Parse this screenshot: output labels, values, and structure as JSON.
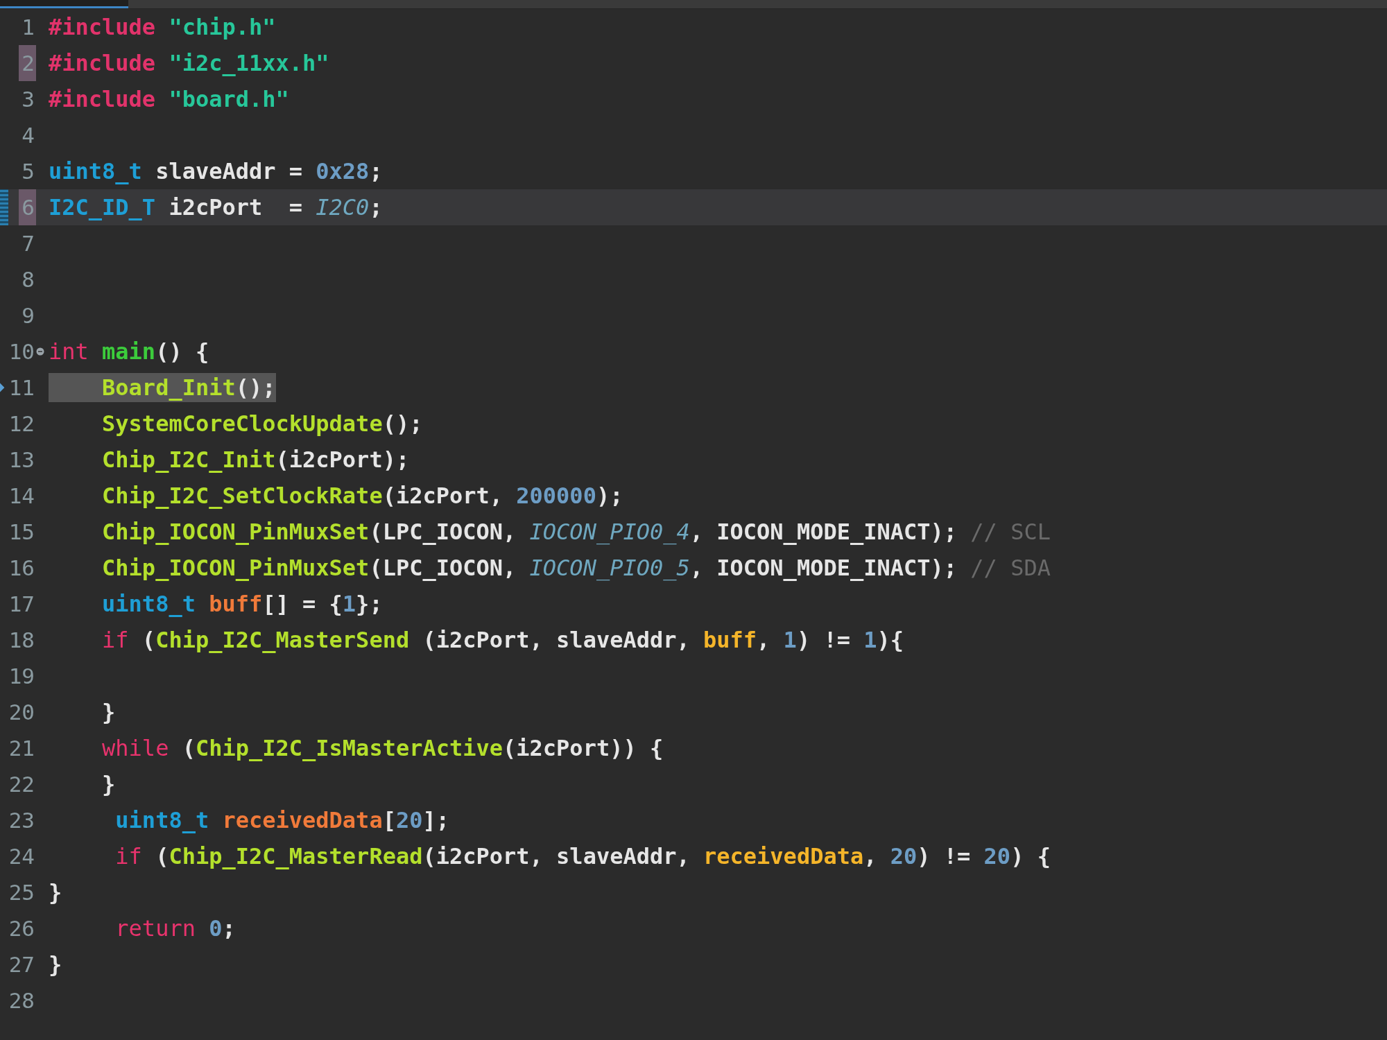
{
  "lines": [
    {
      "number": "1",
      "current": false,
      "bookmark": false,
      "fold": false,
      "pointer": false,
      "selection": false,
      "tokens": [
        {
          "text": "#include ",
          "kind": "directive"
        },
        {
          "text": "\"chip.h\"",
          "kind": "string"
        }
      ]
    },
    {
      "number": "2",
      "current": false,
      "bookmark": true,
      "fold": false,
      "pointer": false,
      "selection": false,
      "tokens": [
        {
          "text": "#include ",
          "kind": "directive"
        },
        {
          "text": "\"i2c_11xx.h\"",
          "kind": "string"
        }
      ]
    },
    {
      "number": "3",
      "current": false,
      "bookmark": false,
      "fold": false,
      "pointer": false,
      "selection": false,
      "tokens": [
        {
          "text": "#include ",
          "kind": "directive"
        },
        {
          "text": "\"board.h\"",
          "kind": "string"
        }
      ]
    },
    {
      "number": "4",
      "current": false,
      "bookmark": false,
      "fold": false,
      "pointer": false,
      "selection": false
    },
    {
      "number": "5",
      "current": false,
      "bookmark": false,
      "fold": false,
      "pointer": false,
      "selection": false,
      "tokens": [
        {
          "text": "uint8_t",
          "kind": "type"
        },
        {
          "text": " slaveAddr = ",
          "kind": "plain"
        },
        {
          "text": "0x28",
          "kind": "number"
        },
        {
          "text": ";",
          "kind": "plain"
        }
      ]
    },
    {
      "number": "6",
      "current": true,
      "bookmark": true,
      "fold": false,
      "pointer": false,
      "selection": false,
      "tokens": [
        {
          "text": "I2C_ID_T",
          "kind": "type"
        },
        {
          "text": " i2cPort  = ",
          "kind": "plain"
        },
        {
          "text": "I2C0",
          "kind": "constant"
        },
        {
          "text": ";",
          "kind": "plain"
        }
      ]
    },
    {
      "number": "7",
      "current": false,
      "bookmark": false,
      "fold": false,
      "pointer": false,
      "selection": false
    },
    {
      "number": "8",
      "current": false,
      "bookmark": false,
      "fold": false,
      "pointer": false,
      "selection": false
    },
    {
      "number": "9",
      "current": false,
      "bookmark": false,
      "fold": false,
      "pointer": false,
      "selection": false
    },
    {
      "number": "10",
      "current": false,
      "bookmark": false,
      "fold": true,
      "pointer": false,
      "selection": false,
      "tokens": [
        {
          "text": "int ",
          "kind": "keyword"
        },
        {
          "text": "main",
          "kind": "entry"
        },
        {
          "text": "() {",
          "kind": "plain"
        }
      ]
    },
    {
      "number": "11",
      "current": false,
      "bookmark": false,
      "fold": false,
      "pointer": true,
      "selection": true,
      "tokens": [
        {
          "text": "    Board_Init",
          "kind": "function"
        },
        {
          "text": "();",
          "kind": "plain"
        }
      ]
    },
    {
      "number": "12",
      "current": false,
      "bookmark": false,
      "fold": false,
      "pointer": false,
      "selection": false,
      "tokens": [
        {
          "text": "    SystemCoreClockUpdate",
          "kind": "function"
        },
        {
          "text": "();",
          "kind": "plain"
        }
      ]
    },
    {
      "number": "13",
      "current": false,
      "bookmark": false,
      "fold": false,
      "pointer": false,
      "selection": false,
      "tokens": [
        {
          "text": "    Chip_I2C_Init",
          "kind": "function"
        },
        {
          "text": "(i2cPort);",
          "kind": "plain"
        }
      ]
    },
    {
      "number": "14",
      "current": false,
      "bookmark": false,
      "fold": false,
      "pointer": false,
      "selection": false,
      "tokens": [
        {
          "text": "    Chip_I2C_SetClockRate",
          "kind": "function"
        },
        {
          "text": "(i2cPort, ",
          "kind": "plain"
        },
        {
          "text": "200000",
          "kind": "number"
        },
        {
          "text": ");",
          "kind": "plain"
        }
      ]
    },
    {
      "number": "15",
      "current": false,
      "bookmark": false,
      "fold": false,
      "pointer": false,
      "selection": false,
      "tokens": [
        {
          "text": "    Chip_IOCON_PinMuxSet",
          "kind": "function"
        },
        {
          "text": "(LPC_IOCON, ",
          "kind": "plain"
        },
        {
          "text": "IOCON_PIO0_4",
          "kind": "constant"
        },
        {
          "text": ", IOCON_MODE_INACT); ",
          "kind": "plain"
        },
        {
          "text": "// SCL",
          "kind": "comment"
        }
      ]
    },
    {
      "number": "16",
      "current": false,
      "bookmark": false,
      "fold": false,
      "pointer": false,
      "selection": false,
      "tokens": [
        {
          "text": "    Chip_IOCON_PinMuxSet",
          "kind": "function"
        },
        {
          "text": "(LPC_IOCON, ",
          "kind": "plain"
        },
        {
          "text": "IOCON_PIO0_5",
          "kind": "constant"
        },
        {
          "text": ", IOCON_MODE_INACT); ",
          "kind": "plain"
        },
        {
          "text": "// SDA",
          "kind": "comment"
        }
      ]
    },
    {
      "number": "17",
      "current": false,
      "bookmark": false,
      "fold": false,
      "pointer": false,
      "selection": false,
      "tokens": [
        {
          "text": "    uint8_t ",
          "kind": "type"
        },
        {
          "text": "buff",
          "kind": "variable"
        },
        {
          "text": "[] = {",
          "kind": "plain"
        },
        {
          "text": "1",
          "kind": "number"
        },
        {
          "text": "};",
          "kind": "plain"
        }
      ]
    },
    {
      "number": "18",
      "current": false,
      "bookmark": false,
      "fold": false,
      "pointer": false,
      "selection": false,
      "tokens": [
        {
          "text": "    if ",
          "kind": "keyword"
        },
        {
          "text": "(",
          "kind": "plain"
        },
        {
          "text": "Chip_I2C_MasterSend",
          "kind": "function"
        },
        {
          "text": " (i2cPort, slaveAddr, ",
          "kind": "plain"
        },
        {
          "text": "buff",
          "kind": "argument"
        },
        {
          "text": ", ",
          "kind": "plain"
        },
        {
          "text": "1",
          "kind": "number"
        },
        {
          "text": ") != ",
          "kind": "plain"
        },
        {
          "text": "1",
          "kind": "number"
        },
        {
          "text": "){",
          "kind": "plain"
        }
      ]
    },
    {
      "number": "19",
      "current": false,
      "bookmark": false,
      "fold": false,
      "pointer": false,
      "selection": false
    },
    {
      "number": "20",
      "current": false,
      "bookmark": false,
      "fold": false,
      "pointer": false,
      "selection": false,
      "tokens": [
        {
          "text": "    }",
          "kind": "plain"
        }
      ]
    },
    {
      "number": "21",
      "current": false,
      "bookmark": false,
      "fold": false,
      "pointer": false,
      "selection": false,
      "tokens": [
        {
          "text": "    while ",
          "kind": "keyword"
        },
        {
          "text": "(",
          "kind": "plain"
        },
        {
          "text": "Chip_I2C_IsMasterActive",
          "kind": "function"
        },
        {
          "text": "(i2cPort)) {",
          "kind": "plain"
        }
      ]
    },
    {
      "number": "22",
      "current": false,
      "bookmark": false,
      "fold": false,
      "pointer": false,
      "selection": false,
      "tokens": [
        {
          "text": "    }",
          "kind": "plain"
        }
      ]
    },
    {
      "number": "23",
      "current": false,
      "bookmark": false,
      "fold": false,
      "pointer": false,
      "selection": false,
      "tokens": [
        {
          "text": "     uint8_t ",
          "kind": "type"
        },
        {
          "text": "receivedData",
          "kind": "variable"
        },
        {
          "text": "[",
          "kind": "plain"
        },
        {
          "text": "20",
          "kind": "number"
        },
        {
          "text": "];",
          "kind": "plain"
        }
      ]
    },
    {
      "number": "24",
      "current": false,
      "bookmark": false,
      "fold": false,
      "pointer": false,
      "selection": false,
      "tokens": [
        {
          "text": "     if ",
          "kind": "keyword"
        },
        {
          "text": "(",
          "kind": "plain"
        },
        {
          "text": "Chip_I2C_MasterRead",
          "kind": "function"
        },
        {
          "text": "(i2cPort, slaveAddr, ",
          "kind": "plain"
        },
        {
          "text": "receivedData",
          "kind": "argument"
        },
        {
          "text": ", ",
          "kind": "plain"
        },
        {
          "text": "20",
          "kind": "number"
        },
        {
          "text": ") != ",
          "kind": "plain"
        },
        {
          "text": "20",
          "kind": "number"
        },
        {
          "text": ") {",
          "kind": "plain"
        }
      ]
    },
    {
      "number": "25",
      "current": false,
      "bookmark": false,
      "fold": false,
      "pointer": false,
      "selection": false,
      "tokens": [
        {
          "text": "}",
          "kind": "plain"
        }
      ]
    },
    {
      "number": "26",
      "current": false,
      "bookmark": false,
      "fold": false,
      "pointer": false,
      "selection": false,
      "tokens": [
        {
          "text": "     return ",
          "kind": "keyword"
        },
        {
          "text": "0",
          "kind": "number"
        },
        {
          "text": ";",
          "kind": "plain"
        }
      ]
    },
    {
      "number": "27",
      "current": false,
      "bookmark": false,
      "fold": false,
      "pointer": false,
      "selection": false,
      "tokens": [
        {
          "text": "}",
          "kind": "plain"
        }
      ]
    },
    {
      "number": "28",
      "current": false,
      "bookmark": false,
      "fold": false,
      "pointer": false,
      "selection": false
    }
  ]
}
